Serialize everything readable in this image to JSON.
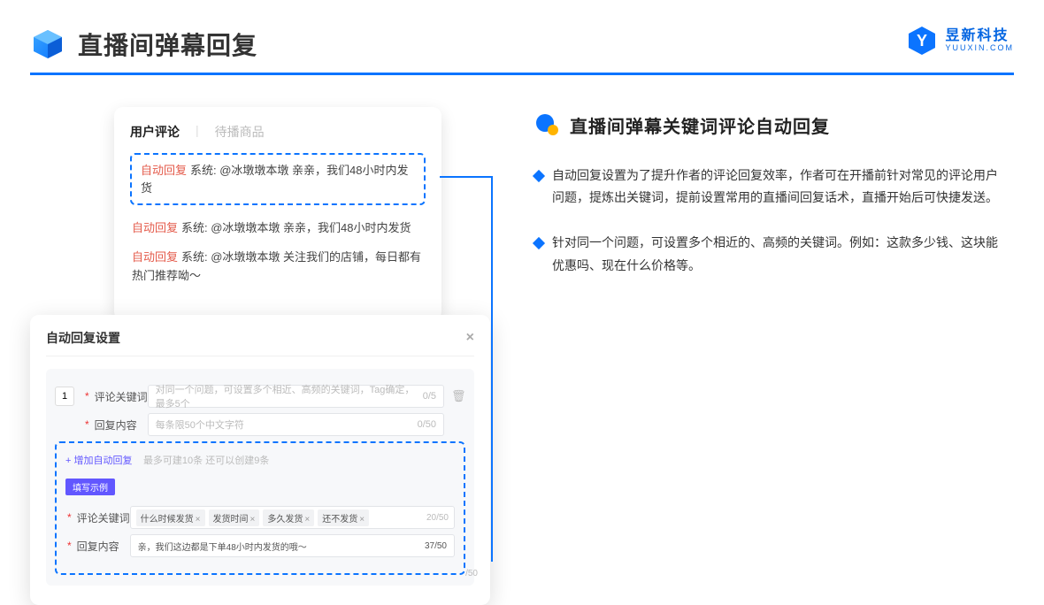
{
  "header": {
    "title": "直播间弹幕回复"
  },
  "brand": {
    "cn": "昱新科技",
    "en": "YUUXIN.COM"
  },
  "comments_panel": {
    "tab_active": "用户评论",
    "tab_inactive": "待播商品",
    "highlight": {
      "tag": "自动回复",
      "text": "系统: @冰墩墩本墩 亲亲，我们48小时内发货"
    },
    "rows": [
      {
        "tag": "自动回复",
        "text": "系统: @冰墩墩本墩 亲亲，我们48小时内发货"
      },
      {
        "tag": "自动回复",
        "text": "系统: @冰墩墩本墩 关注我们的店铺，每日都有热门推荐呦～"
      }
    ]
  },
  "settings_panel": {
    "title": "自动回复设置",
    "index": "1",
    "keyword_label": "评论关键词",
    "keyword_placeholder": "对同一个问题，可设置多个相近、高频的关键词，Tag确定，最多5个",
    "keyword_count": "0/5",
    "content_label": "回复内容",
    "content_placeholder": "每条限50个中文字符",
    "content_count": "0/50",
    "add_text": "+ 增加自动回复",
    "add_hint": "最多可建10条 还可以创建9条",
    "example_badge": "填写示例",
    "ex_keyword_label": "评论关键词",
    "ex_tags": [
      "什么时候发货",
      "发货时间",
      "多久发货",
      "还不发货"
    ],
    "ex_kw_count": "20/50",
    "ex_content_label": "回复内容",
    "ex_content_value": "亲，我们这边都是下单48小时内发货的哦～",
    "ex_content_count": "37/50",
    "outer_count": "/50"
  },
  "right": {
    "section_title": "直播间弹幕关键词评论自动回复",
    "bullets": [
      "自动回复设置为了提升作者的评论回复效率，作者可在开播前针对常见的评论用户问题，提炼出关键词，提前设置常用的直播间回复话术，直播开始后可快捷发送。",
      "针对同一个问题，可设置多个相近的、高频的关键词。例如：这款多少钱、这块能优惠吗、现在什么价格等。"
    ]
  }
}
